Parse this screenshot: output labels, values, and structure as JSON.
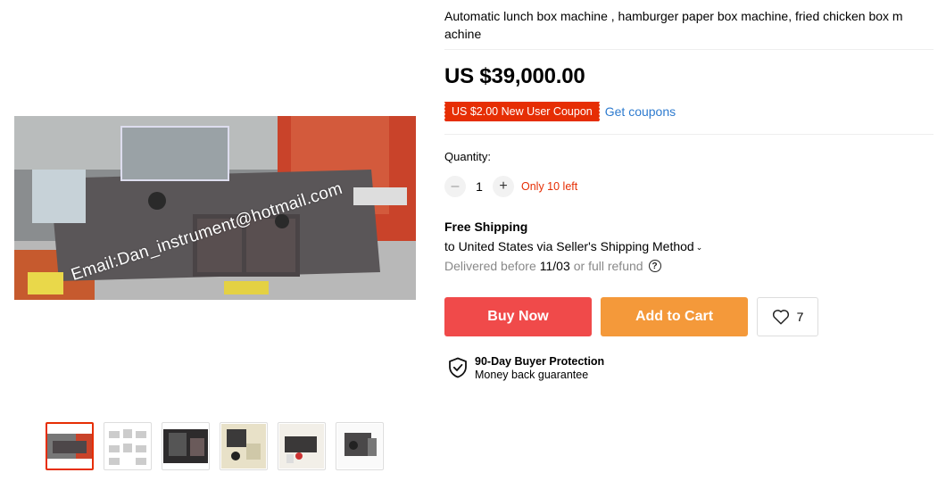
{
  "product": {
    "title": "Automatic lunch box machine , hamburger paper box machine, fried chicken box m achine",
    "price": "US $39,000.00"
  },
  "gallery": {
    "watermark": "Email:Dan_instrument@hotmail.com",
    "thumbnails": [
      "thumb-1",
      "thumb-2",
      "thumb-3",
      "thumb-4",
      "thumb-5",
      "thumb-6"
    ]
  },
  "coupon": {
    "badge": "US $2.00 New User Coupon",
    "link": "Get coupons"
  },
  "quantity": {
    "label": "Quantity:",
    "minus": "–",
    "plus": "+",
    "value": "1",
    "stock": "Only 10 left"
  },
  "shipping": {
    "title": "Free Shipping",
    "destination": "to United States via Seller's Shipping Method",
    "chevron": "⌄",
    "delivery_prefix": "Delivered before",
    "delivery_date": "11/03",
    "delivery_suffix": "or full refund",
    "help_icon": "?"
  },
  "actions": {
    "buy_now": "Buy Now",
    "add_to_cart": "Add to Cart",
    "wishlist_count": "7"
  },
  "protection": {
    "title": "90-Day Buyer Protection",
    "subtitle": "Money back guarantee"
  },
  "colors": {
    "accent_red": "#e62e04",
    "buy_now": "#f04a4a",
    "add_to_cart": "#f4993a",
    "link_blue": "#2e7bcf"
  }
}
